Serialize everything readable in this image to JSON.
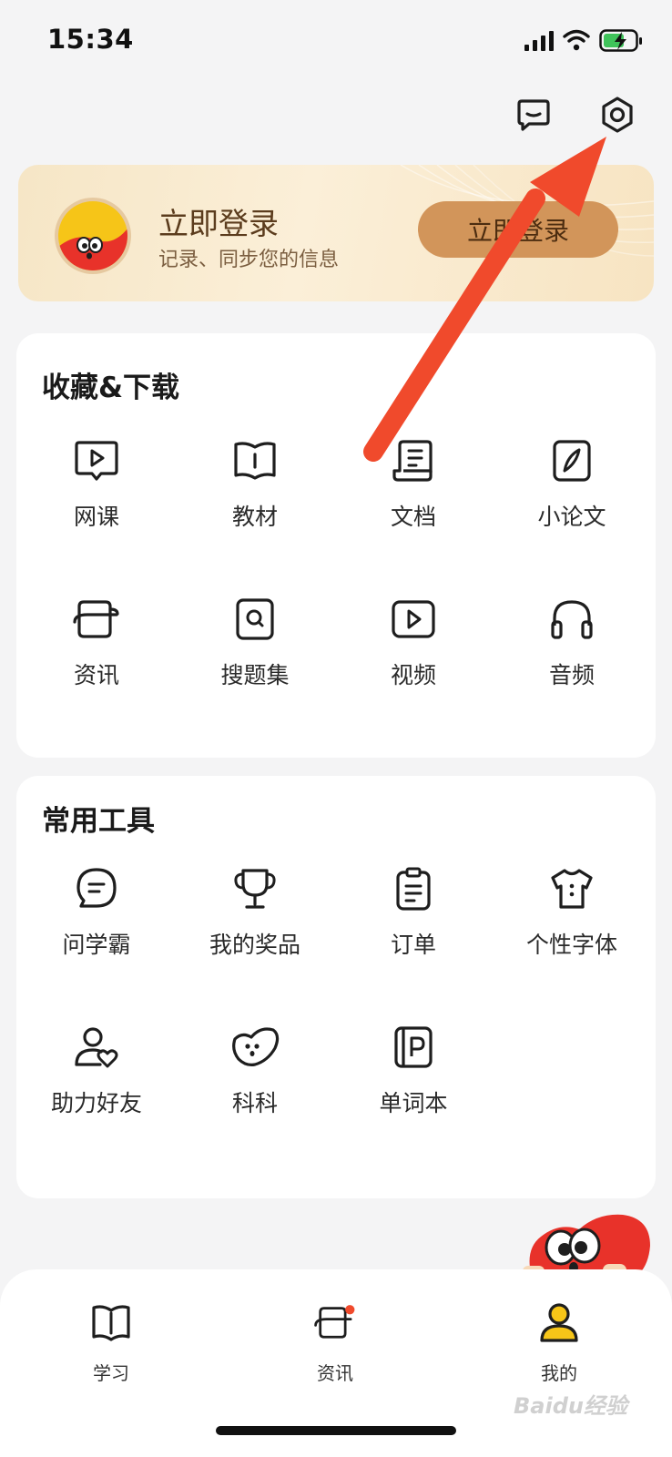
{
  "status": {
    "time": "15:34"
  },
  "colors": {
    "accent_red": "#f04a2c",
    "login_btn": "#d2955a",
    "login_text": "#5b3c1d",
    "tab_active": "#f6c518"
  },
  "icons": {
    "message": "message-square-icon",
    "settings": "settings-gear-icon",
    "signal": "signal-bars-icon",
    "wifi": "wifi-icon",
    "battery": "battery-charging-icon"
  },
  "login": {
    "title": "立即登录",
    "subtitle": "记录、同步您的信息",
    "button": "立即登录"
  },
  "favorites": {
    "title": "收藏&下载",
    "items": [
      {
        "label": "网课",
        "icon": "video-course-icon"
      },
      {
        "label": "教材",
        "icon": "textbook-icon"
      },
      {
        "label": "文档",
        "icon": "document-scroll-icon"
      },
      {
        "label": "小论文",
        "icon": "essay-pen-icon"
      },
      {
        "label": "资讯",
        "icon": "news-icon"
      },
      {
        "label": "搜题集",
        "icon": "search-question-icon"
      },
      {
        "label": "视频",
        "icon": "video-play-icon"
      },
      {
        "label": "音频",
        "icon": "headphones-icon"
      }
    ]
  },
  "tools": {
    "title": "常用工具",
    "items": [
      {
        "label": "问学霸",
        "icon": "chat-bubble-icon"
      },
      {
        "label": "我的奖品",
        "icon": "trophy-icon"
      },
      {
        "label": "订单",
        "icon": "clipboard-icon"
      },
      {
        "label": "个性字体",
        "icon": "tshirt-icon"
      },
      {
        "label": "助力好友",
        "icon": "friend-heart-icon"
      },
      {
        "label": "科科",
        "icon": "mascot-heart-icon"
      },
      {
        "label": "单词本",
        "icon": "word-book-icon"
      }
    ]
  },
  "tabs": [
    {
      "label": "学习",
      "icon": "book-icon"
    },
    {
      "label": "资讯",
      "icon": "news-icon",
      "badge": true
    },
    {
      "label": "我的",
      "icon": "user-icon",
      "active": true
    }
  ],
  "watermark": "Baidu经验"
}
